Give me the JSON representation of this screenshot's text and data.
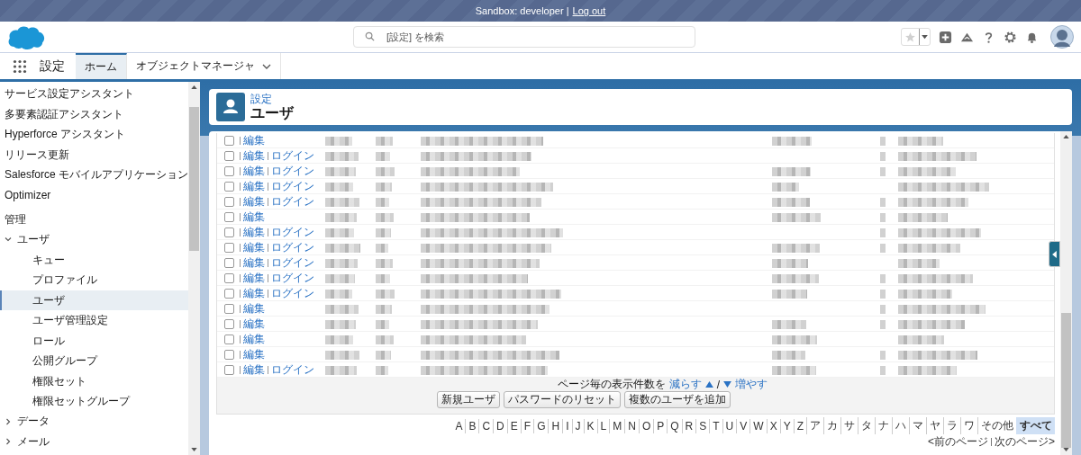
{
  "banner": {
    "text": "Sandbox: developer |",
    "link": "Log out"
  },
  "search": {
    "placeholder": "[設定] を検索"
  },
  "nav": {
    "app_name": "設定",
    "tabs": [
      {
        "label": "ホーム",
        "selected": true,
        "dropdown": false
      },
      {
        "label": "オブジェクトマネージャ",
        "selected": false,
        "dropdown": true
      }
    ]
  },
  "sidebar": [
    {
      "label": "サービス設定アシスタント",
      "kind": "link",
      "selected": false
    },
    {
      "label": "多要素認証アシスタント",
      "kind": "link",
      "selected": false
    },
    {
      "label": "Hyperforce アシスタント",
      "kind": "link",
      "selected": false
    },
    {
      "label": "リリース更新",
      "kind": "link",
      "selected": false
    },
    {
      "label": "Salesforce モバイルアプリケーション",
      "kind": "link",
      "selected": false
    },
    {
      "label": "Optimizer",
      "kind": "link",
      "selected": false
    },
    {
      "label": "管理",
      "kind": "heading"
    },
    {
      "label": "ユーザ",
      "kind": "group",
      "expanded": true,
      "children": [
        {
          "label": "キュー",
          "selected": false
        },
        {
          "label": "プロファイル",
          "selected": false
        },
        {
          "label": "ユーザ",
          "selected": true
        },
        {
          "label": "ユーザ管理設定",
          "selected": false
        },
        {
          "label": "ロール",
          "selected": false
        },
        {
          "label": "公開グループ",
          "selected": false
        },
        {
          "label": "権限セット",
          "selected": false
        },
        {
          "label": "権限セットグループ",
          "selected": false
        }
      ]
    },
    {
      "label": "データ",
      "kind": "group",
      "expanded": false
    },
    {
      "label": "メール",
      "kind": "group",
      "expanded": false
    }
  ],
  "page_header": {
    "breadcrumb": "設定",
    "title": "ユーザ"
  },
  "rows": [
    {
      "checked": false,
      "actions": [
        "編集"
      ]
    },
    {
      "checked": false,
      "actions": [
        "編集",
        "ログイン"
      ]
    },
    {
      "checked": false,
      "actions": [
        "編集",
        "ログイン"
      ]
    },
    {
      "checked": false,
      "actions": [
        "編集",
        "ログイン"
      ]
    },
    {
      "checked": false,
      "actions": [
        "編集",
        "ログイン"
      ]
    },
    {
      "checked": false,
      "actions": [
        "編集"
      ]
    },
    {
      "checked": false,
      "actions": [
        "編集",
        "ログイン"
      ]
    },
    {
      "checked": false,
      "actions": [
        "編集",
        "ログイン"
      ]
    },
    {
      "checked": false,
      "actions": [
        "編集",
        "ログイン"
      ]
    },
    {
      "checked": false,
      "actions": [
        "編集",
        "ログイン"
      ]
    },
    {
      "checked": false,
      "actions": [
        "編集",
        "ログイン"
      ]
    },
    {
      "checked": false,
      "actions": [
        "編集"
      ]
    },
    {
      "checked": false,
      "actions": [
        "編集"
      ]
    },
    {
      "checked": false,
      "actions": [
        "編集"
      ]
    },
    {
      "checked": false,
      "actions": [
        "編集"
      ]
    },
    {
      "checked": false,
      "actions": [
        "編集",
        "ログイン"
      ]
    }
  ],
  "page_size": {
    "label": "ページ毎の表示件数を",
    "fewer": "減らす",
    "slash": "/",
    "more": "増やす"
  },
  "buttons": [
    "新規ユーザ",
    "パスワードのリセット",
    "複数のユーザを追加"
  ],
  "letters": [
    {
      "label": "A",
      "selected": false
    },
    {
      "label": "B",
      "selected": false
    },
    {
      "label": "C",
      "selected": false
    },
    {
      "label": "D",
      "selected": false
    },
    {
      "label": "E",
      "selected": false
    },
    {
      "label": "F",
      "selected": false
    },
    {
      "label": "G",
      "selected": false
    },
    {
      "label": "H",
      "selected": false
    },
    {
      "label": "I",
      "selected": false
    },
    {
      "label": "J",
      "selected": false
    },
    {
      "label": "K",
      "selected": false
    },
    {
      "label": "L",
      "selected": false
    },
    {
      "label": "M",
      "selected": false
    },
    {
      "label": "N",
      "selected": false
    },
    {
      "label": "O",
      "selected": false
    },
    {
      "label": "P",
      "selected": false
    },
    {
      "label": "Q",
      "selected": false
    },
    {
      "label": "R",
      "selected": false
    },
    {
      "label": "S",
      "selected": false
    },
    {
      "label": "T",
      "selected": false
    },
    {
      "label": "U",
      "selected": false
    },
    {
      "label": "V",
      "selected": false
    },
    {
      "label": "W",
      "selected": false
    },
    {
      "label": "X",
      "selected": false
    },
    {
      "label": "Y",
      "selected": false
    },
    {
      "label": "Z",
      "selected": false
    },
    {
      "label": "ア",
      "selected": false
    },
    {
      "label": "カ",
      "selected": false
    },
    {
      "label": "サ",
      "selected": false
    },
    {
      "label": "タ",
      "selected": false
    },
    {
      "label": "ナ",
      "selected": false
    },
    {
      "label": "ハ",
      "selected": false
    },
    {
      "label": "マ",
      "selected": false
    },
    {
      "label": "ヤ",
      "selected": false
    },
    {
      "label": "ラ",
      "selected": false
    },
    {
      "label": "ワ",
      "selected": false
    },
    {
      "label": "その他",
      "selected": false
    },
    {
      "label": "すべて",
      "selected": true
    }
  ],
  "pager": {
    "prev": "<前のページ",
    "next": "次のページ>"
  }
}
